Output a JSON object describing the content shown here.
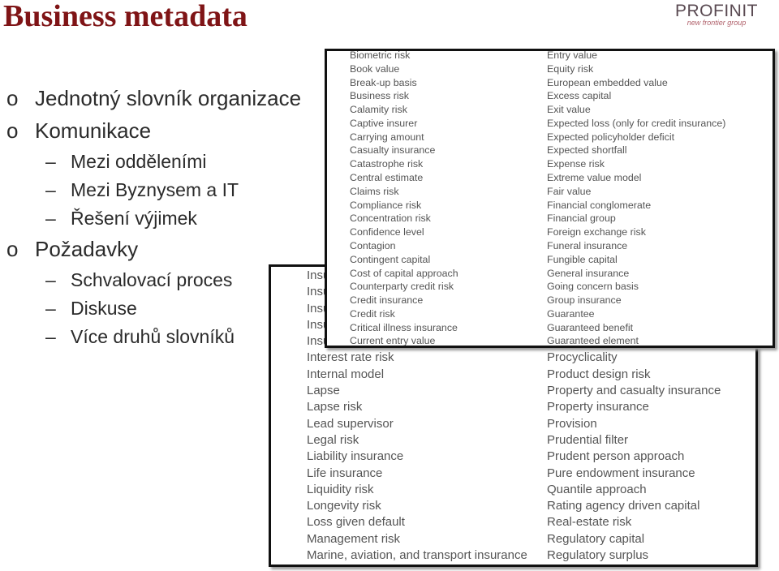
{
  "title": "Business metadata",
  "logo": {
    "name": "PROFINIT",
    "tagline": "new frontier group"
  },
  "bullets": [
    {
      "level": 1,
      "marker": "o",
      "text": "Jednotný slovník organizace"
    },
    {
      "level": 1,
      "marker": "o",
      "text": "Komunikace"
    },
    {
      "level": 2,
      "marker": "–",
      "text": "Mezi odděleními"
    },
    {
      "level": 2,
      "marker": "–",
      "text": "Mezi Byznysem a IT"
    },
    {
      "level": 2,
      "marker": "–",
      "text": "Řešení výjimek"
    },
    {
      "level": 1,
      "marker": "o",
      "text": "Požadavky"
    },
    {
      "level": 2,
      "marker": "–",
      "text": "Schvalovací proces"
    },
    {
      "level": 2,
      "marker": "–",
      "text": "Diskuse"
    },
    {
      "level": 2,
      "marker": "–",
      "text": "Více druhů slovníků"
    }
  ],
  "back_glossary": {
    "left": [
      "Insu",
      "Insu",
      "Insu",
      "Insu",
      "Insu",
      "Interest rate risk",
      "Internal model",
      "Lapse",
      "Lapse risk",
      "Lead supervisor",
      "Legal risk",
      "Liability insurance",
      "Life insurance",
      "Liquidity risk",
      "Longevity risk",
      "Loss given default",
      "Management risk",
      "Marine, aviation, and transport insurance"
    ],
    "right": [
      "",
      "",
      "",
      "",
      "",
      "Procyclicality",
      "Product design risk",
      "Property and casualty insurance",
      "Property insurance",
      "Provision",
      "Prudential filter",
      "Prudent person approach",
      "Pure endowment insurance",
      "Quantile approach",
      "Rating agency driven capital",
      "Real-estate risk",
      "Regulatory capital",
      "Regulatory surplus"
    ]
  },
  "front_glossary": {
    "left": [
      "Biometric risk",
      "Book value",
      "Break-up basis",
      "Business risk",
      "Calamity risk",
      "Captive insurer",
      "Carrying amount",
      "Casualty insurance",
      "Catastrophe risk",
      "Central estimate",
      "Claims risk",
      "Compliance risk",
      "Concentration risk",
      "Confidence level",
      "Contagion",
      "Contingent capital",
      "Cost of capital approach",
      "Counterparty credit risk",
      "Credit insurance",
      "Credit risk",
      "Critical illness insurance",
      "Current entry value"
    ],
    "right": [
      "Entry value",
      "Equity risk",
      "European embedded value",
      "Excess capital",
      "Exit value",
      "Expected loss (only for credit insurance)",
      "Expected policyholder deficit",
      "Expected shortfall",
      "Expense risk",
      "Extreme value model",
      "Fair value",
      "Financial conglomerate",
      "Financial group",
      "Foreign exchange risk",
      "Funeral insurance",
      "Fungible capital",
      "General insurance",
      "Going concern basis",
      "Group insurance",
      "Guarantee",
      "Guaranteed benefit",
      "Guaranteed element"
    ]
  },
  "colors": {
    "title": "#7f1416",
    "text": "#2b2b2b",
    "glossary_text": "#555555"
  }
}
